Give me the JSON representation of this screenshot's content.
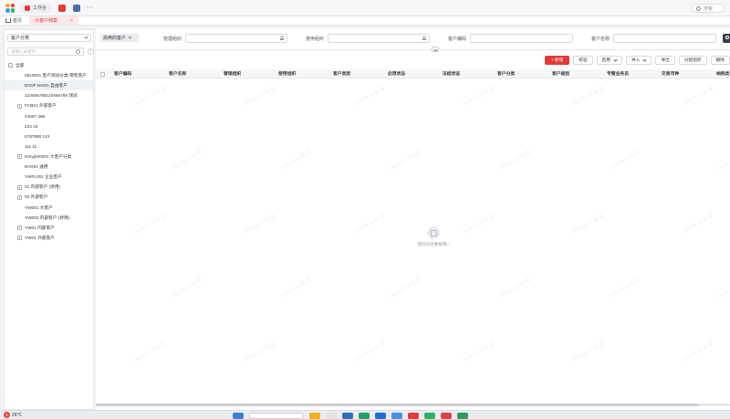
{
  "topbar": {
    "tab_workbench": "工作台",
    "more": "···",
    "search_placeholder": "搜索"
  },
  "navbar": {
    "home": "首页",
    "active_tab": "大客户档案",
    "close": "×"
  },
  "sidebar": {
    "category_select": "客户分类",
    "search_placeholder": "请输入关键字",
    "collapse": "‹",
    "tree": [
      {
        "label": "全部",
        "toggle": "−",
        "level": 0
      },
      {
        "label": "0510001 客户测试分类-零售客户",
        "toggle": "",
        "level": 1
      },
      {
        "label": "BYDF-test01 自由客户",
        "toggle": "",
        "level": 1,
        "selected": true
      },
      {
        "label": "1234567891234567​89 测试",
        "toggle": "",
        "level": 1
      },
      {
        "label": "FCB01 外部客户",
        "toggle": "+",
        "level": 1
      },
      {
        "label": "24567 456",
        "toggle": "",
        "level": 1
      },
      {
        "label": "234 34",
        "toggle": "",
        "level": 1
      },
      {
        "label": "6787890 123",
        "toggle": "",
        "level": 1
      },
      {
        "label": "111 11",
        "toggle": "",
        "level": 1
      },
      {
        "label": "testyjh00001 大客户分类",
        "toggle": "+",
        "level": 1
      },
      {
        "label": "BYD01 通用",
        "toggle": "",
        "level": 1
      },
      {
        "label": "YWFL001 企业客户",
        "toggle": "",
        "level": 1
      },
      {
        "label": "01 内部客户 (停用)",
        "toggle": "+",
        "level": 1
      },
      {
        "label": "02 外部客户",
        "toggle": "+",
        "level": 1
      },
      {
        "label": "YW001 大客户",
        "toggle": "",
        "level": 1
      },
      {
        "label": "YW002 内部客户 (停用)",
        "toggle": "",
        "level": 1
      },
      {
        "label": "YW01 内部客户",
        "toggle": "+",
        "level": 1
      },
      {
        "label": "YW02 外部客户",
        "toggle": "+",
        "level": 1
      }
    ]
  },
  "filters": {
    "status": "启用的客户",
    "org_label": "管理组织",
    "use_org_label": "使用组织",
    "code_label": "客户编码",
    "name_label": "客户名称"
  },
  "actions": {
    "add": "+ 新增",
    "validate": "校验",
    "enable": "启用",
    "import": "导入",
    "export": "导出",
    "assign_org": "分配组织",
    "delete": "删除"
  },
  "table": {
    "columns": [
      "客户编码",
      "客户名称",
      "管理组织",
      "使用组织",
      "客户类型",
      "启用状态",
      "冻结状态",
      "客户分类",
      "客户级别",
      "专管业务员",
      "交易币种",
      "纳税类"
    ],
    "empty_text": "暂时没有数据哦~"
  },
  "watermark": "2025-03-14 陈 某",
  "taskbar": {
    "weather_badge": "2",
    "temperature": "26°C"
  },
  "colors": {
    "accent": "#e03a3a",
    "selected_row": "#eef1f6",
    "header_bg": "#f5f6f8"
  }
}
